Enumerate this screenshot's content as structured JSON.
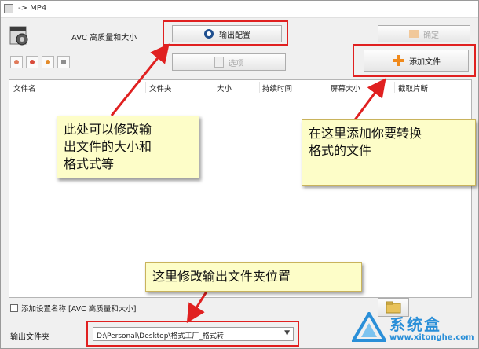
{
  "window": {
    "title": "-> MP4"
  },
  "format": {
    "label": "AVC 高质量和大小"
  },
  "buttons": {
    "output_config": "输出配置",
    "options": "选项",
    "confirm": "确定",
    "add_file": "添加文件"
  },
  "toolbar": {
    "icons": [
      "image-icon",
      "delete-icon",
      "play-icon",
      "media-info-icon"
    ]
  },
  "table": {
    "columns": [
      "文件名",
      "文件夹",
      "大小",
      "持续时间",
      "屏幕大小",
      "截取片断"
    ],
    "rows": []
  },
  "checkbox": {
    "label": "添加设置名称 [AVC 高质量和大小]",
    "checked": false
  },
  "output": {
    "label": "输出文件夹",
    "path": "D:\\Personal\\Desktop\\格式工厂_格式转"
  },
  "annotations": {
    "note_output_config": [
      "此处可以修改输",
      "出文件的大小和",
      "格式式等"
    ],
    "note_add_file": [
      "在这里添加你要转换",
      "格式的文件"
    ],
    "note_output_folder": "这里修改输出文件夹位置"
  },
  "watermark": {
    "name": "系统盒",
    "site": "www.xitonghe.com"
  },
  "colors": {
    "highlight": "#e02020",
    "note_bg": "#fdfdc8",
    "add_icon": "#f08a1c",
    "watermark": "#2a8fd8"
  }
}
